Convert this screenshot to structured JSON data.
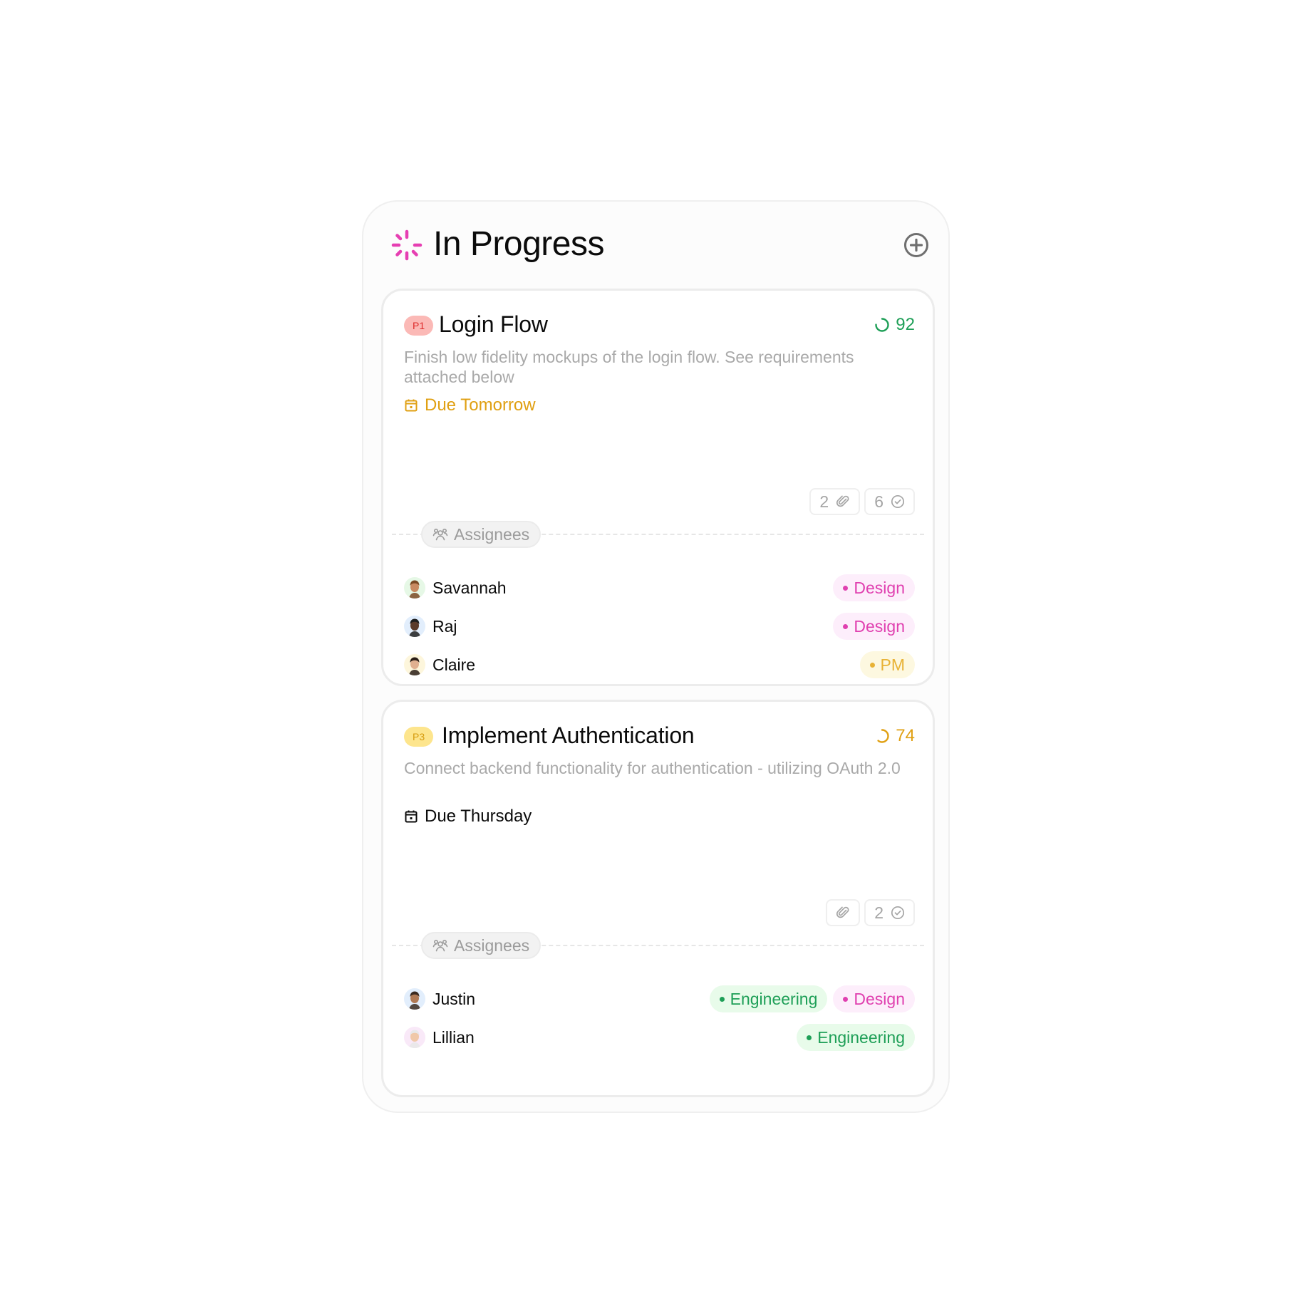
{
  "colors": {
    "accent_pink": "#e63fb2",
    "green": "#1e9f57",
    "amber": "#e0a013",
    "muted_text": "#a9a9a9",
    "icon_gray": "#6f6f6f"
  },
  "header": {
    "icon": "spinner-icon",
    "title": "In Progress",
    "add_button_icon": "plus-circle-icon"
  },
  "cards": [
    {
      "priority": "P1",
      "priority_bg": "#fbb9b6",
      "priority_fg": "#de2a2a",
      "title": "Login Flow",
      "progress": 92,
      "progress_label": "92",
      "progress_color": "#1e9f57",
      "description": "Finish low fidelity mockups of the login flow. See requirements attached below",
      "due_label": "Due Tomorrow",
      "due_color": "#e0a013",
      "attachments": "2",
      "attachments_icon": "paperclip-icon",
      "checks": "6",
      "checks_icon": "check-circle-icon",
      "assignees_label": "Assignees",
      "assignees": [
        {
          "name": "Savannah",
          "avatar_bg": "#e6f8e6",
          "tags": [
            {
              "label": "Design",
              "kind": "design"
            }
          ]
        },
        {
          "name": "Raj",
          "avatar_bg": "#e2eefc",
          "tags": [
            {
              "label": "Design",
              "kind": "design"
            }
          ]
        },
        {
          "name": "Claire",
          "avatar_bg": "#fdf6dc",
          "tags": [
            {
              "label": "PM",
              "kind": "pm"
            }
          ]
        }
      ]
    },
    {
      "priority": "P3",
      "priority_bg": "#fde58d",
      "priority_fg": "#d59a0c",
      "title": "Implement Authentication",
      "progress": 74,
      "progress_label": "74",
      "progress_color": "#e0a013",
      "description": "Connect backend functionality for authentication - utilizing OAuth 2.0",
      "due_label": "Due Thursday",
      "due_color": "#0b0b0b",
      "attachments": "",
      "attachments_icon": "paperclip-icon",
      "checks": "2",
      "checks_icon": "check-circle-icon",
      "assignees_label": "Assignees",
      "assignees": [
        {
          "name": "Justin",
          "avatar_bg": "#e2eefc",
          "tags": [
            {
              "label": "Engineering",
              "kind": "engineering"
            },
            {
              "label": "Design",
              "kind": "design"
            }
          ]
        },
        {
          "name": "Lillian",
          "avatar_bg": "#f9e9f8",
          "tags": [
            {
              "label": "Engineering",
              "kind": "engineering"
            }
          ]
        }
      ]
    }
  ],
  "tag_styles": {
    "design": {
      "bg": "#fdeefb",
      "fg": "#e040b0"
    },
    "pm": {
      "bg": "#fdf8e0",
      "fg": "#e8b235"
    },
    "engineering": {
      "bg": "#e8fbea",
      "fg": "#1e9f57"
    }
  }
}
